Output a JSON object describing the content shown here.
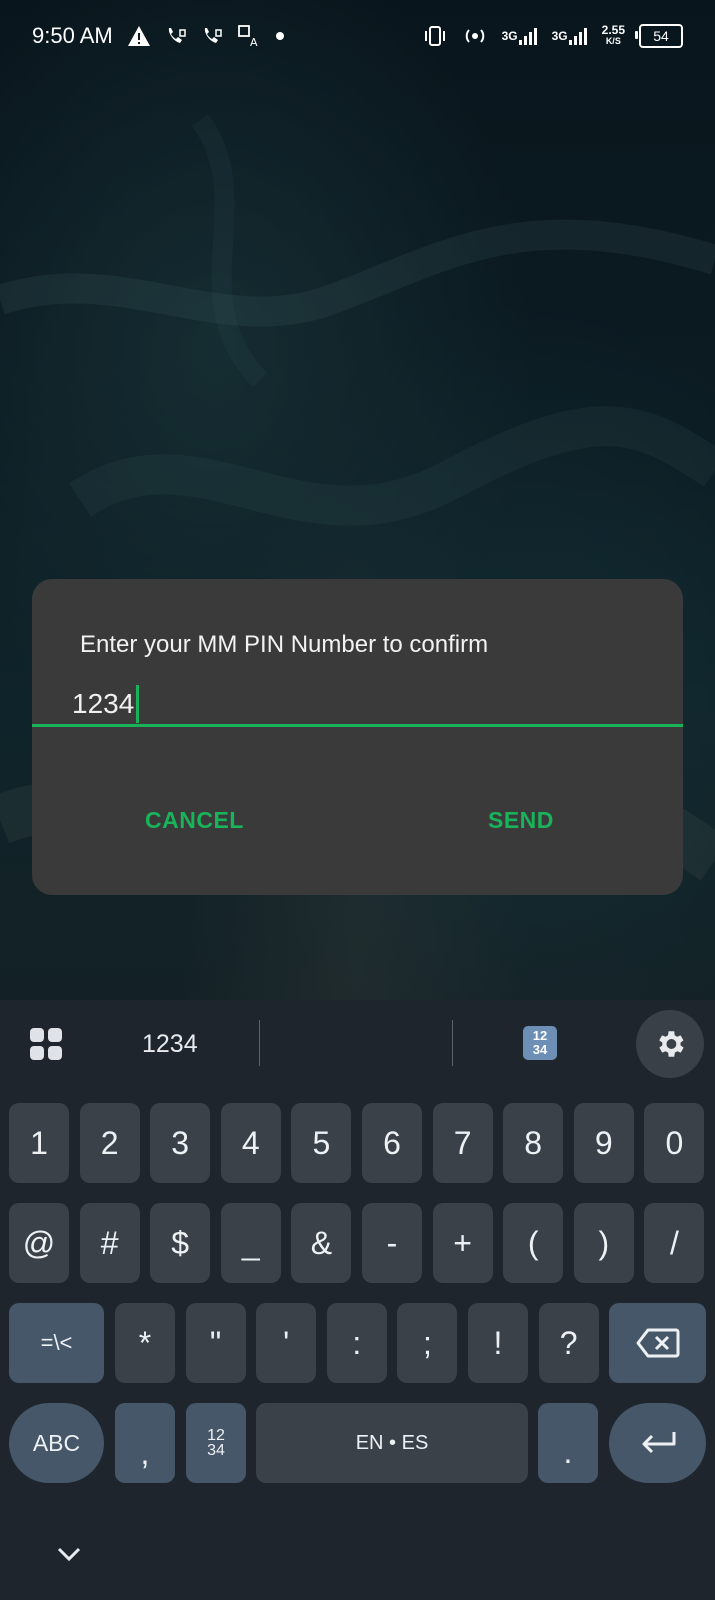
{
  "status_bar": {
    "time": "9:50 AM",
    "speed_value": "2.55",
    "speed_unit": "K/S",
    "battery": "54",
    "net1": "3G",
    "net2": "3G"
  },
  "dialog": {
    "title": "Enter your MM PIN Number to confirm",
    "pin_value": "1234",
    "cancel_label": "CANCEL",
    "send_label": "SEND",
    "accent_color": "#19b35a"
  },
  "keyboard": {
    "suggestion": "1234",
    "row1": [
      "1",
      "2",
      "3",
      "4",
      "5",
      "6",
      "7",
      "8",
      "9",
      "0"
    ],
    "row2": [
      "@",
      "#",
      "$",
      "_",
      "&",
      "-",
      "+",
      "(",
      ")",
      "/"
    ],
    "row3": [
      "=\\<",
      "*",
      "\"",
      "'",
      ":",
      ";",
      "!",
      "?"
    ],
    "abc_label": "ABC",
    "comma": ",",
    "numpad_top": "12",
    "numpad_bottom": "34",
    "space_label": "EN • ES",
    "period": "."
  }
}
